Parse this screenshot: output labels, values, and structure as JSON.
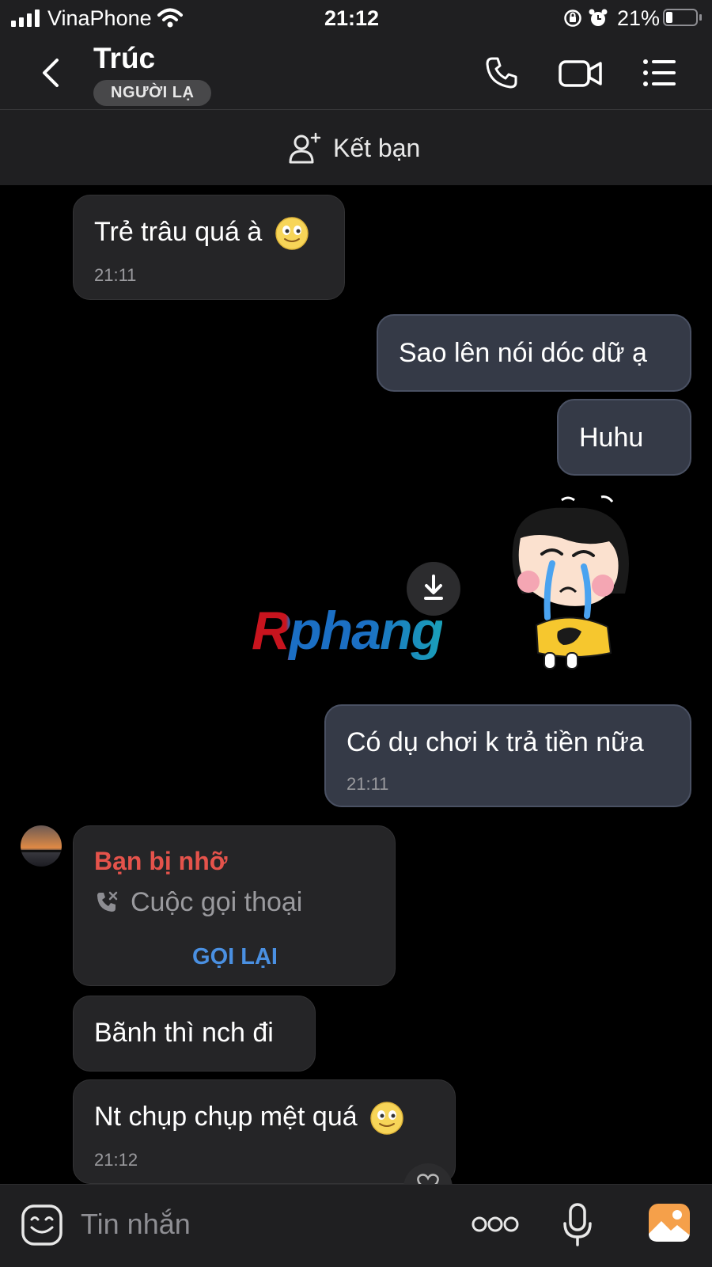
{
  "status_bar": {
    "carrier": "VinaPhone",
    "time": "21:12",
    "battery_percent": "21%",
    "battery_level": 0.21
  },
  "header": {
    "contact_name": "Trúc",
    "badge": "NGƯỜI LẠ",
    "icons": [
      "back-icon",
      "phone-icon",
      "video-icon",
      "menu-icon"
    ]
  },
  "banner": {
    "add_friend_label": "Kết bạn",
    "icon": "add-user-icon"
  },
  "messages": [
    {
      "side": "in",
      "text": "Trẻ trâu quá à",
      "emoji": "smile-emoji",
      "time": "21:11"
    },
    {
      "side": "out",
      "text": "Sao lên nói dóc dữ ạ"
    },
    {
      "side": "out",
      "text": "Huhu"
    },
    {
      "side": "out",
      "type": "sticker",
      "sticker": "crying-baby-sticker",
      "download_icon": "download-icon"
    },
    {
      "side": "out",
      "text": "Có dụ chơi k trả tiền nữa",
      "time": "21:11"
    },
    {
      "side": "in",
      "type": "missed-call",
      "title": "Bạn bị nhỡ",
      "subtitle": "Cuộc gọi thoại",
      "action": "GỌI LẠI"
    },
    {
      "side": "in",
      "text": "Bãnh thì nch đi"
    },
    {
      "side": "in",
      "text": "Nt chụp chụp mệt quá",
      "emoji": "smile-emoji",
      "time": "21:12"
    }
  ],
  "watermark": "Rphang",
  "input_bar": {
    "placeholder": "Tin nhắn",
    "icons": [
      "sticker-icon",
      "more-icon",
      "microphone-icon",
      "image-icon"
    ]
  },
  "colors": {
    "background": "#000000",
    "bar": "#1f1f21",
    "incoming_bubble": "#252527",
    "outgoing_bubble": "#353a47",
    "missed_call_title": "#e5534b",
    "call_back": "#4a90e2",
    "image_icon": "#f5a04a"
  }
}
